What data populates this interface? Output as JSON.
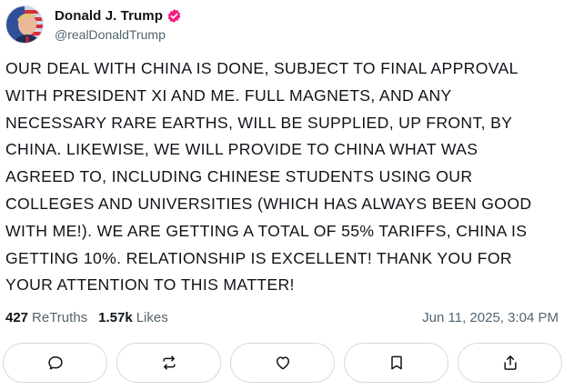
{
  "author": {
    "display_name": "Donald J. Trump",
    "handle": "@realDonaldTrump",
    "verified_badge_color": "#f91880"
  },
  "post": {
    "lines": [
      "OUR DEAL WITH CHINA IS DONE, SUBJECT TO FINAL APPROVAL",
      "WITH PRESIDENT XI AND ME. FULL MAGNETS, AND ANY",
      "NECESSARY RARE EARTHS, WILL BE SUPPLIED, UP FRONT, BY",
      "CHINA. LIKEWISE, WE WILL PROVIDE TO CHINA WHAT WAS",
      "AGREED TO, INCLUDING CHINESE STUDENTS USING OUR",
      "COLLEGES AND UNIVERSITIES (WHICH HAS ALWAYS BEEN GOOD",
      "WITH ME!). WE ARE GETTING A TOTAL OF 55% TARIFFS, CHINA IS",
      "GETTING 10%. RELATIONSHIP IS EXCELLENT! THANK YOU FOR",
      "YOUR ATTENTION TO THIS MATTER!"
    ]
  },
  "stats": {
    "retruths_count": "427",
    "retruths_label": "ReTruths",
    "likes_count": "1.57k",
    "likes_label": "Likes",
    "timestamp": "Jun 11, 2025, 3:04 PM"
  },
  "actions": [
    {
      "name": "reply-button",
      "icon": "reply-icon"
    },
    {
      "name": "retruth-button",
      "icon": "retruth-icon"
    },
    {
      "name": "like-button",
      "icon": "heart-icon"
    },
    {
      "name": "bookmark-button",
      "icon": "bookmark-icon"
    },
    {
      "name": "share-button",
      "icon": "share-icon"
    }
  ],
  "colors": {
    "text": "#0f1419",
    "secondary": "#536471",
    "border": "#d5d9de"
  }
}
